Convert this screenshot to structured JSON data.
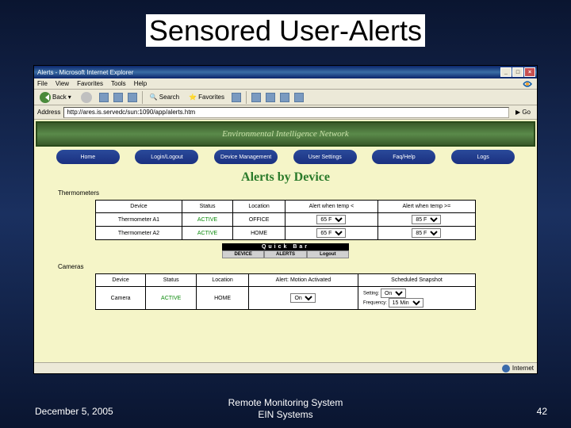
{
  "slide": {
    "title": "Sensored User-Alerts",
    "footer_date": "December 5, 2005",
    "footer_center_l1": "Remote Monitoring System",
    "footer_center_l2": "EIN Systems",
    "page_number": "42"
  },
  "browser": {
    "title": "Alerts - Microsoft Internet Explorer",
    "menu": {
      "file": "File",
      "view": "View",
      "favorites": "Favorites",
      "tools": "Tools",
      "help": "Help"
    },
    "toolbar": {
      "back": "Back",
      "search": "Search",
      "favorites": "Favorites"
    },
    "address_label": "Address",
    "url": "http://ares.is.servedc/sun:1090/app/alerts.htm",
    "go": "Go",
    "status_zone": "Internet"
  },
  "page": {
    "banner_tagline": "Environmental Intelligence Network",
    "nav": [
      "Home",
      "Login/Logout",
      "Device Management",
      "User Settings",
      "Faq/Help",
      "Logs"
    ],
    "heading": "Alerts by Device",
    "section_thermo": "Thermometers",
    "section_cameras": "Cameras",
    "thermo_headers": {
      "device": "Device",
      "status": "Status",
      "location": "Location",
      "low": "Alert when temp <",
      "high": "Alert when temp >="
    },
    "thermo_rows": [
      {
        "device": "Thermometer A1",
        "status": "ACTIVE",
        "location": "OFFICE",
        "low": "65 F",
        "high": "85 F"
      },
      {
        "device": "Thermometer A2",
        "status": "ACTIVE",
        "location": "HOME",
        "low": "65 F",
        "high": "85 F"
      }
    ],
    "camera_headers": {
      "device": "Device",
      "status": "Status",
      "location": "Location",
      "motion": "Alert: Motion Activated",
      "snapshot": "Scheduled Snapshot"
    },
    "camera_row": {
      "device": "Camera",
      "status": "ACTIVE",
      "location": "HOME",
      "motion": "On",
      "setting_label": "Setting:",
      "setting_val": "On",
      "freq_label": "Frequency:",
      "freq_val": "15 Min"
    },
    "quickbar": {
      "title": "Quick Bar",
      "device": "DEVICE",
      "alerts": "ALERTS",
      "logout": "Logout"
    }
  }
}
